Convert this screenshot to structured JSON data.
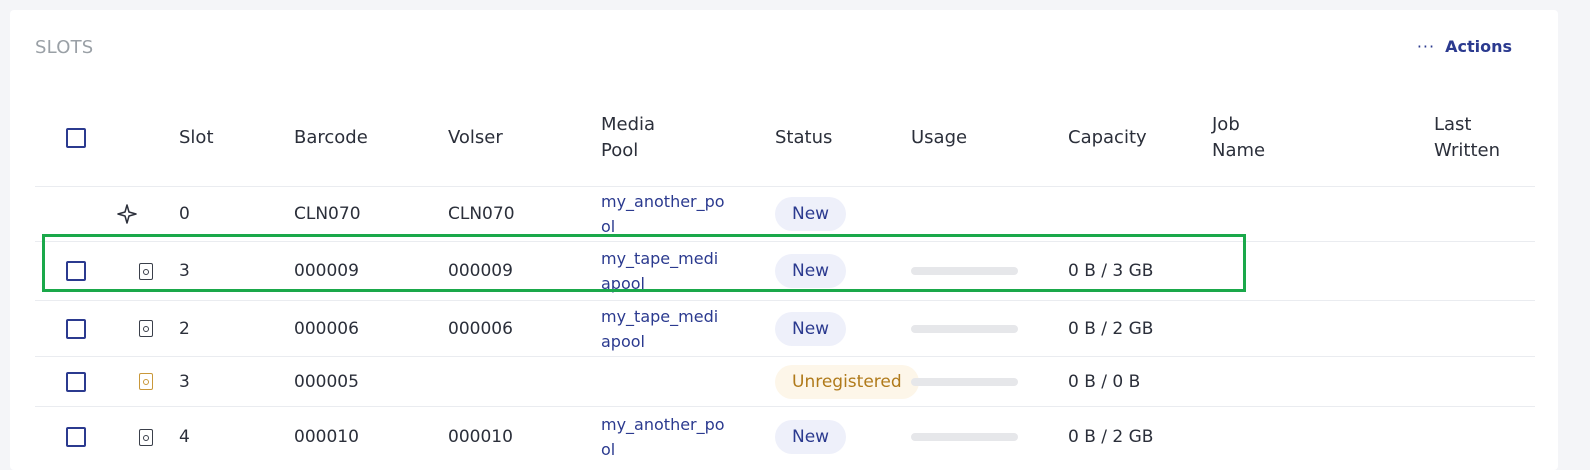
{
  "panel": {
    "title": "SLOTS",
    "actions_label": "Actions",
    "actions_icon": "more-horizontal-icon"
  },
  "columns": [
    "Slot",
    "Barcode",
    "Volser",
    "Media Pool",
    "Status",
    "Usage",
    "Capacity",
    "Job Name",
    "Last Written"
  ],
  "rows": [
    {
      "icon": "sparkle-icon",
      "has_checkbox": false,
      "slot": "0",
      "barcode": "CLN070",
      "volser": "CLN070",
      "media_pool": "my_another_pool",
      "status": "New",
      "status_kind": "new",
      "usage_fraction": null,
      "capacity": "",
      "job_name": "",
      "last_written": ""
    },
    {
      "icon": "tape-icon",
      "has_checkbox": true,
      "slot": "3",
      "barcode": "000009",
      "volser": "000009",
      "media_pool": "my_tape_mediapool",
      "status": "New",
      "status_kind": "new",
      "usage_fraction": 0,
      "capacity": "0 B / 3 GB",
      "job_name": "",
      "last_written": "",
      "highlighted": true
    },
    {
      "icon": "tape-icon",
      "has_checkbox": true,
      "slot": "2",
      "barcode": "000006",
      "volser": "000006",
      "media_pool": "my_tape_mediapool",
      "status": "New",
      "status_kind": "new",
      "usage_fraction": 0,
      "capacity": "0 B / 2 GB",
      "job_name": "",
      "last_written": ""
    },
    {
      "icon": "tape-warning-icon",
      "has_checkbox": true,
      "slot": "3",
      "barcode": "000005",
      "volser": "",
      "media_pool": "",
      "status": "Unregistered",
      "status_kind": "unregistered",
      "usage_fraction": 0,
      "capacity": "0 B / 0 B",
      "job_name": "",
      "last_written": ""
    },
    {
      "icon": "tape-icon",
      "has_checkbox": true,
      "slot": "4",
      "barcode": "000010",
      "volser": "000010",
      "media_pool": "my_another_pool",
      "status": "New",
      "status_kind": "new",
      "usage_fraction": 0,
      "capacity": "0 B / 2 GB",
      "job_name": "",
      "last_written": ""
    }
  ],
  "colors": {
    "accent": "#2b3a8f",
    "highlight": "#1aa84a",
    "warning": "#b07a1a"
  }
}
